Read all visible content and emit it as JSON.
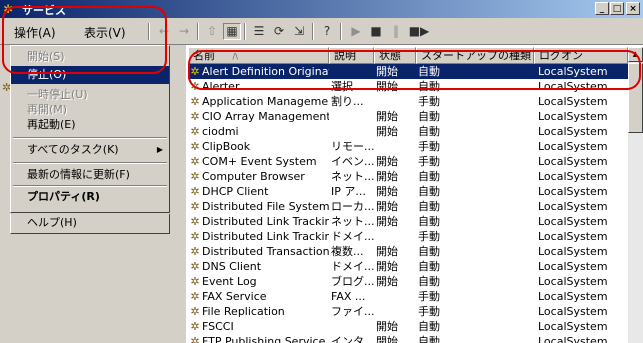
{
  "window": {
    "title": "サービス",
    "min_label": "_",
    "max_label": "□",
    "close_label": "×"
  },
  "menubar": {
    "action": "操作(A)",
    "view": "表示(V)"
  },
  "toolbar": {
    "back": "←",
    "forward": "→",
    "up": "⇧",
    "show_tree": "▦",
    "properties": "☰",
    "refresh": "⟳",
    "export": "⇲",
    "help": "?",
    "play": "▶",
    "stop": "■",
    "pause": "‖",
    "restart": "■▶"
  },
  "dropdown": [
    {
      "label": "開始(S)",
      "state": "disabled"
    },
    {
      "label": "停止(O)",
      "state": "selected"
    },
    {
      "label": "一時停止(U)",
      "state": "disabled"
    },
    {
      "label": "再開(M)",
      "state": "disabled"
    },
    {
      "label": "再起動(E)",
      "state": "normal"
    },
    {
      "label": "すべてのタスク(K)",
      "state": "normal",
      "submenu": "▶"
    },
    {
      "label": "最新の情報に更新(F)",
      "state": "normal"
    },
    {
      "label": "プロパティ(R)",
      "state": "bold"
    },
    {
      "label": "ヘルプ(H)",
      "state": "normal"
    }
  ],
  "columns": {
    "name": "名前",
    "name_sort": "/\\",
    "desc": "説明",
    "status": "状態",
    "startup": "スタートアップの種類",
    "logon": "ログオン"
  },
  "services": [
    {
      "name": "Alert Definition Originator",
      "desc": "",
      "status": "開始",
      "startup": "自動",
      "logon": "LocalSystem"
    },
    {
      "name": "Alerter",
      "desc": "選択...",
      "status": "開始",
      "startup": "自動",
      "logon": "LocalSystem"
    },
    {
      "name": "Application Management",
      "desc": "割り...",
      "status": "",
      "startup": "手動",
      "logon": "LocalSystem"
    },
    {
      "name": "CIO Array Management S...",
      "desc": "",
      "status": "開始",
      "startup": "自動",
      "logon": "LocalSystem"
    },
    {
      "name": "ciodmi",
      "desc": "",
      "status": "開始",
      "startup": "自動",
      "logon": "LocalSystem"
    },
    {
      "name": "ClipBook",
      "desc": "リモー...",
      "status": "",
      "startup": "手動",
      "logon": "LocalSystem"
    },
    {
      "name": "COM+ Event System",
      "desc": "イベン...",
      "status": "開始",
      "startup": "手動",
      "logon": "LocalSystem"
    },
    {
      "name": "Computer Browser",
      "desc": "ネット...",
      "status": "開始",
      "startup": "自動",
      "logon": "LocalSystem"
    },
    {
      "name": "DHCP Client",
      "desc": "IP ア...",
      "status": "開始",
      "startup": "自動",
      "logon": "LocalSystem"
    },
    {
      "name": "Distributed File System",
      "desc": "ローカ...",
      "status": "開始",
      "startup": "自動",
      "logon": "LocalSystem"
    },
    {
      "name": "Distributed Link Tracking ...",
      "desc": "ネット...",
      "status": "開始",
      "startup": "自動",
      "logon": "LocalSystem"
    },
    {
      "name": "Distributed Link Tracking ...",
      "desc": "ドメイ...",
      "status": "",
      "startup": "手動",
      "logon": "LocalSystem"
    },
    {
      "name": "Distributed Transaction C...",
      "desc": "複数...",
      "status": "開始",
      "startup": "自動",
      "logon": "LocalSystem"
    },
    {
      "name": "DNS Client",
      "desc": "ドメイ...",
      "status": "開始",
      "startup": "自動",
      "logon": "LocalSystem"
    },
    {
      "name": "Event Log",
      "desc": "ブログ...",
      "status": "開始",
      "startup": "自動",
      "logon": "LocalSystem"
    },
    {
      "name": "FAX Service",
      "desc": "FAX ...",
      "status": "",
      "startup": "手動",
      "logon": "LocalSystem"
    },
    {
      "name": "File Replication",
      "desc": "ファイ...",
      "status": "",
      "startup": "手動",
      "logon": "LocalSystem"
    },
    {
      "name": "FSCCI",
      "desc": "",
      "status": "開始",
      "startup": "自動",
      "logon": "LocalSystem"
    },
    {
      "name": "FTP Publishing Service",
      "desc": "インタ...",
      "status": "開始",
      "startup": "自動",
      "logon": "LocalSystem"
    }
  ],
  "colors": {
    "selection": "#0a246a",
    "highlight_box": "#e00000",
    "face": "#d4d0c8"
  }
}
